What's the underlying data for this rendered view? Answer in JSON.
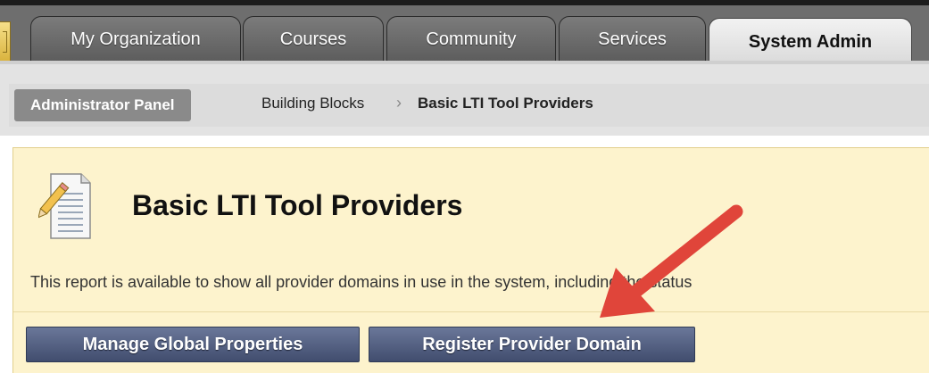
{
  "tabs": [
    {
      "label": "My Organization",
      "active": false
    },
    {
      "label": "Courses",
      "active": false
    },
    {
      "label": "Community",
      "active": false
    },
    {
      "label": "Services",
      "active": false
    },
    {
      "label": "System Admin",
      "active": true
    }
  ],
  "breadcrumb": {
    "panel_label": "Administrator Panel",
    "items": [
      "Building Blocks",
      "Basic LTI Tool Providers"
    ],
    "separator": "›"
  },
  "page": {
    "title": "Basic LTI Tool Providers",
    "description": "This report is available to show all provider domains in use in the system, including the status"
  },
  "buttons": {
    "manage_global": "Manage Global Properties",
    "register_domain": "Register Provider Domain"
  },
  "icons": {
    "page_icon": "document-pencil-icon",
    "annotation": "red-arrow-annotation"
  },
  "colors": {
    "tab_active_bg": "#e6e6e6",
    "content_bg": "#fdf3cd",
    "button_bg": "#4f5b7c",
    "annotation_arrow": "#e0453a"
  }
}
